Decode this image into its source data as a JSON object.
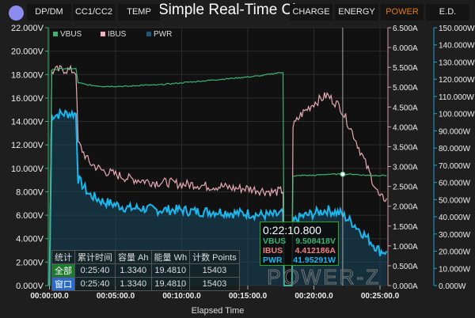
{
  "tabs": [
    {
      "label": "DP/DM"
    },
    {
      "label": "CC1/CC2"
    },
    {
      "label": "TEMP"
    },
    {
      "label": "CHARGE"
    },
    {
      "label": "ENERGY"
    },
    {
      "label": "POWER",
      "active": true
    },
    {
      "label": "E.D."
    }
  ],
  "title": "Simple Real-Time Chart",
  "watermark": "POWER-Z",
  "chart_data": {
    "type": "line",
    "xlabel": "Elapsed Time",
    "x_ticks": [
      "00:00:00.0",
      "00:05:00.0",
      "00:10:00.0",
      "00:15:00.0",
      "00:20:00.0",
      "00:25:00.0"
    ],
    "xlim_seconds": [
      0,
      1540
    ],
    "y_axes": [
      {
        "unit": "V",
        "range": [
          0,
          22
        ],
        "ticks": [
          "0.000V",
          "2.000V",
          "4.000V",
          "6.000V",
          "8.000V",
          "10.000V",
          "12.000V",
          "14.000V",
          "16.000V",
          "18.000V",
          "20.000V",
          "22.000V"
        ],
        "color": "#3cb371"
      },
      {
        "unit": "A",
        "range": [
          0,
          6.5
        ],
        "ticks": [
          "0.000A",
          "0.500A",
          "1.000A",
          "1.500A",
          "2.000A",
          "2.500A",
          "3.000A",
          "3.500A",
          "4.000A",
          "4.500A",
          "5.000A",
          "5.500A",
          "6.000A",
          "6.500A"
        ],
        "color": "#d9a0aa"
      },
      {
        "unit": "W",
        "range": [
          0,
          150
        ],
        "ticks": [
          "0.000W",
          "10.000W",
          "20.000W",
          "30.000W",
          "40.000W",
          "50.000W",
          "60.000W",
          "70.000W",
          "80.000W",
          "90.000W",
          "100.000W",
          "110.000W",
          "120.000W",
          "130.000W",
          "140.000W",
          "150.000W"
        ],
        "color": "#1aa3d9"
      }
    ],
    "legend_position": "top-left",
    "grid": true,
    "x": [
      "00:00:00",
      "00:00:10",
      "00:01:00",
      "00:02:00",
      "00:02:10",
      "00:03:00",
      "00:04:00",
      "00:05:00",
      "00:06:00",
      "00:07:00",
      "00:08:00",
      "00:09:00",
      "00:10:00",
      "00:11:00",
      "00:12:00",
      "00:13:00",
      "00:14:00",
      "00:15:00",
      "00:16:00",
      "00:17:00",
      "00:17:40",
      "00:17:45",
      "00:18:20",
      "00:18:25",
      "00:19:00",
      "00:20:00",
      "00:21:00",
      "00:22:00",
      "00:23:00",
      "00:24:00",
      "00:25:00",
      "00:25:30"
    ],
    "series": [
      {
        "name": "VBUS",
        "color": "#3cb371",
        "axis": 0,
        "values": [
          0,
          18.4,
          18.5,
          18.5,
          17.3,
          17.1,
          17.0,
          17.0,
          17.0,
          17.1,
          17.1,
          17.2,
          17.3,
          17.4,
          17.5,
          17.6,
          17.7,
          17.8,
          17.9,
          18.1,
          18.2,
          0,
          0,
          9.3,
          9.4,
          9.4,
          9.5,
          9.5,
          9.5,
          9.4,
          9.4,
          9.4
        ]
      },
      {
        "name": "IBUS",
        "color": "#e8aab4",
        "axis": 1,
        "values": [
          0,
          5.4,
          5.45,
          5.4,
          3.6,
          3.1,
          2.9,
          2.8,
          2.7,
          2.65,
          2.6,
          2.6,
          2.55,
          2.55,
          2.5,
          2.5,
          2.45,
          2.45,
          2.4,
          2.35,
          2.4,
          0,
          0,
          4.0,
          4.3,
          4.6,
          4.8,
          4.5,
          3.8,
          3.0,
          2.2,
          2.2
        ]
      },
      {
        "name": "PWR",
        "color": "#1ab8f0",
        "axis": 2,
        "values": [
          0,
          99,
          100,
          100,
          62,
          53,
          49,
          47,
          45,
          45,
          44,
          44,
          44,
          43,
          43,
          43,
          42,
          42,
          41,
          41,
          42,
          0,
          0,
          37,
          40,
          42,
          44,
          42,
          36,
          28,
          20,
          20
        ]
      }
    ],
    "cursor": {
      "time": "0:22:10.800",
      "seconds": 1330.8,
      "values": [
        {
          "name": "VBUS",
          "value": "9.508418V",
          "color": "#3cb371"
        },
        {
          "name": "IBUS",
          "value": "4.412186A",
          "color": "#f08080"
        },
        {
          "name": "PWR",
          "value": "41.95291W",
          "color": "#1ab8f0"
        }
      ]
    }
  },
  "stats": {
    "headers": [
      "统计",
      "累计时间",
      "容量 Ah",
      "能量 Wh",
      "计数 Points"
    ],
    "rows": [
      [
        "全部",
        "0:25:40",
        "1.3340",
        "19.4810",
        "15403"
      ],
      [
        "窗口",
        "0:25:40",
        "1.3340",
        "19.4810",
        "15403"
      ]
    ]
  }
}
